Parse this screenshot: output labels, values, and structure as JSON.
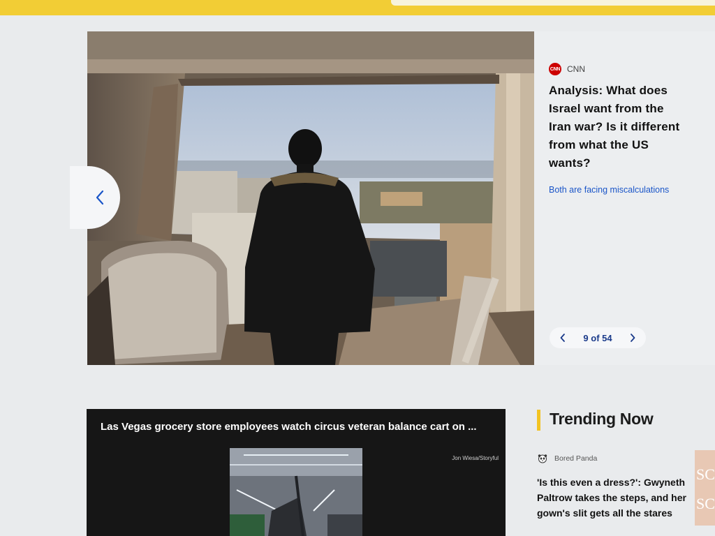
{
  "colors": {
    "header_yellow": "#f2cd35",
    "link_blue": "#1a55c8",
    "pager_blue": "#1a3a8a",
    "cnn_red": "#cc0000",
    "trending_accent": "#f2c322"
  },
  "hero": {
    "source_logo_text": "CNN",
    "source_name": "CNN",
    "headline": "Analysis: What does Israel want from the Iran war? Is it different from what the US wants?",
    "subheadline_link": "Both are facing miscalculations",
    "pager": {
      "count_text": "9 of 54",
      "prev_icon": "chevron-left-icon",
      "next_icon": "chevron-right-icon"
    },
    "prev_slide_icon": "chevron-left-icon"
  },
  "video": {
    "title": "Las Vegas grocery store employees watch circus veteran balance cart on ...",
    "credit": "Jon Wiesa/Storyful"
  },
  "trending": {
    "title": "Trending Now",
    "items": [
      {
        "source": "Bored Panda",
        "source_icon": "panda-icon",
        "headline": "'Is this even a dress?': Gwyneth Paltrow takes the steps, and her gown's slit gets all the stares",
        "thumb_text": "SC"
      }
    ]
  }
}
